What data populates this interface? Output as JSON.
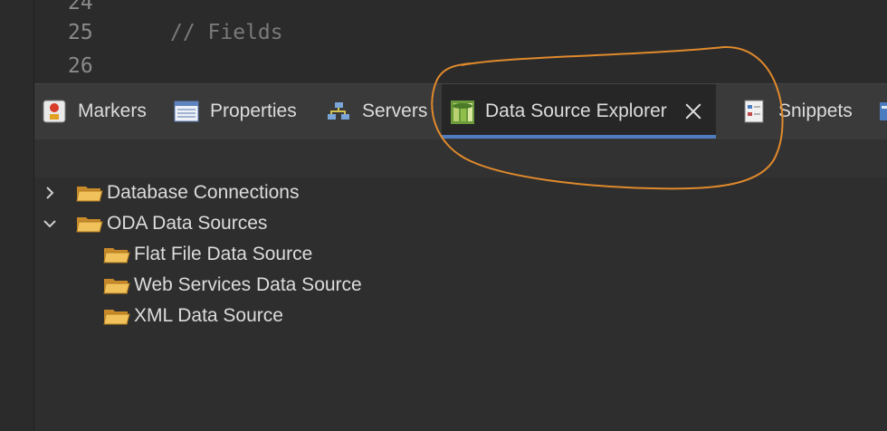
{
  "editor": {
    "lines": [
      {
        "number": "24",
        "code": ""
      },
      {
        "number": "25",
        "code": "// Fields"
      },
      {
        "number": "26",
        "code": ""
      }
    ]
  },
  "tabs": [
    {
      "label": "Markers",
      "icon": "markers-icon"
    },
    {
      "label": "Properties",
      "icon": "properties-icon"
    },
    {
      "label": "Servers",
      "icon": "servers-icon"
    },
    {
      "label": "Data Source Explorer",
      "icon": "data-source-explorer-icon",
      "active": true
    },
    {
      "label": "Snippets",
      "icon": "snippets-icon"
    }
  ],
  "tree": {
    "items": [
      {
        "label": "Database Connections",
        "expanded": false
      },
      {
        "label": "ODA Data Sources",
        "expanded": true
      },
      {
        "label": "Flat File Data Source"
      },
      {
        "label": "Web Services Data Source"
      },
      {
        "label": "XML Data Source"
      }
    ]
  },
  "colors": {
    "active_tab_underline": "#4f7dc0",
    "annotation": "#e08a2c",
    "folder": "#e8b04a"
  }
}
